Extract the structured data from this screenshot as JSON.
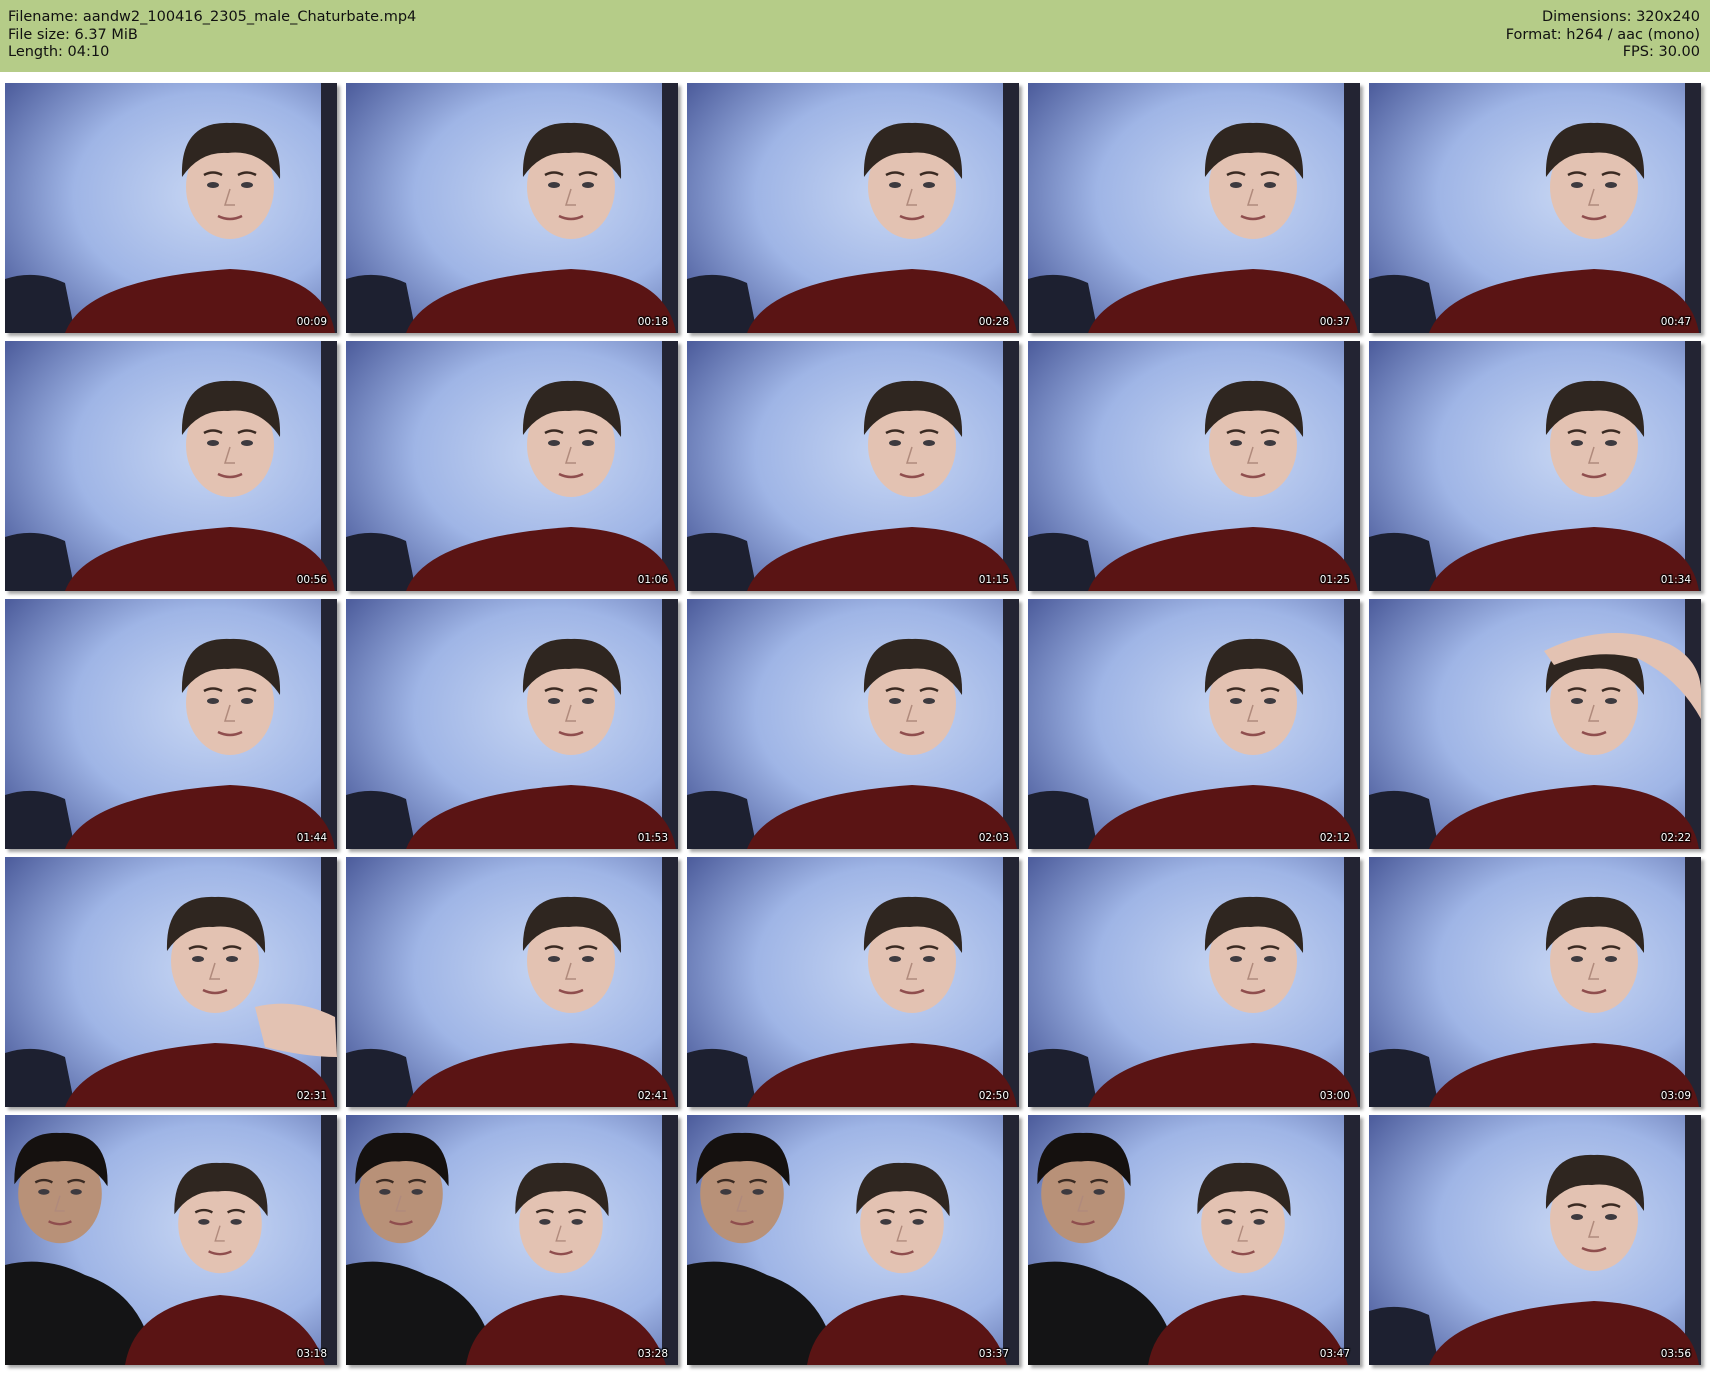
{
  "header": {
    "left": [
      {
        "label": "Filename:",
        "value": "aandw2_100416_2305_male_Chaturbate.mp4"
      },
      {
        "label": "File size:",
        "value": "6.37 MiB"
      },
      {
        "label": "Length:",
        "value": "04:10"
      }
    ],
    "right": [
      {
        "label": "Dimensions:",
        "value": "320x240"
      },
      {
        "label": "Format:",
        "value": "h264 / aac (mono)"
      },
      {
        "label": "FPS:",
        "value": "30.00"
      }
    ]
  },
  "colors": {
    "header_bg": "#b5cc88",
    "wall": "#9fb5e6",
    "shirt": "#5a1414",
    "hair": "#2f2620",
    "skin": "#e3c2b2"
  },
  "thumbnails": [
    {
      "time": "00:09",
      "pose": "solo"
    },
    {
      "time": "00:18",
      "pose": "solo"
    },
    {
      "time": "00:28",
      "pose": "solo"
    },
    {
      "time": "00:37",
      "pose": "solo"
    },
    {
      "time": "00:47",
      "pose": "solo"
    },
    {
      "time": "00:56",
      "pose": "solo"
    },
    {
      "time": "01:06",
      "pose": "solo"
    },
    {
      "time": "01:15",
      "pose": "solo"
    },
    {
      "time": "01:25",
      "pose": "solo"
    },
    {
      "time": "01:34",
      "pose": "solo"
    },
    {
      "time": "01:44",
      "pose": "solo"
    },
    {
      "time": "01:53",
      "pose": "solo"
    },
    {
      "time": "02:03",
      "pose": "solo"
    },
    {
      "time": "02:12",
      "pose": "solo"
    },
    {
      "time": "02:22",
      "pose": "arm-raised"
    },
    {
      "time": "02:31",
      "pose": "hand-on-neck"
    },
    {
      "time": "02:41",
      "pose": "solo"
    },
    {
      "time": "02:50",
      "pose": "solo"
    },
    {
      "time": "03:00",
      "pose": "solo"
    },
    {
      "time": "03:09",
      "pose": "solo"
    },
    {
      "time": "03:18",
      "pose": "two-people"
    },
    {
      "time": "03:28",
      "pose": "two-people"
    },
    {
      "time": "03:37",
      "pose": "two-people"
    },
    {
      "time": "03:47",
      "pose": "two-people"
    },
    {
      "time": "03:56",
      "pose": "solo"
    }
  ]
}
